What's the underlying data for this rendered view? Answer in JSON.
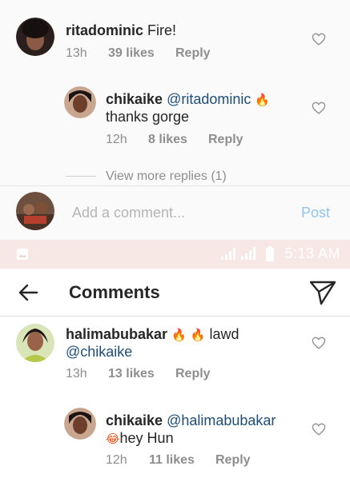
{
  "thread_top": {
    "comment": {
      "username": "ritadominic",
      "text": "Fire!",
      "time": "13h",
      "likes": "39 likes",
      "reply": "Reply"
    },
    "reply": {
      "username": "chikaike",
      "mention": "@ritadominic",
      "emoji": "🔥",
      "text": "thanks gorge",
      "time": "12h",
      "likes": "8 likes",
      "reply": "Reply"
    },
    "view_more": "View more replies (1)"
  },
  "composer": {
    "placeholder": "Add a comment...",
    "post_label": "Post"
  },
  "status_bar": {
    "time": "5:13 AM"
  },
  "header": {
    "title": "Comments"
  },
  "thread_bottom": {
    "comment": {
      "username": "halimabubakar",
      "emoji1": "🔥",
      "emoji2": "🔥",
      "text": "lawd",
      "mention": "@chikaike",
      "time": "13h",
      "likes": "13 likes",
      "reply": "Reply"
    },
    "reply": {
      "username": "chikaike",
      "mention": "@halimabubakar",
      "emoji": "😂",
      "text": "hey Hun",
      "time": "12h",
      "likes": "11 likes",
      "reply": "Reply"
    }
  },
  "colors": {
    "mention": "#1f4d7a",
    "meta": "#8e8e8e",
    "post": "#8fc5f2",
    "statusbar": "#f7e8e6"
  }
}
